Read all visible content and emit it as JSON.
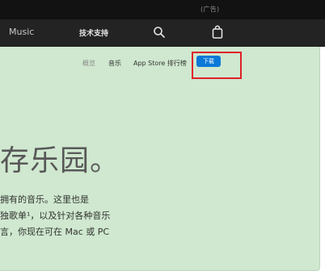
{
  "ad_label": "(广告)",
  "nav": {
    "music_label": "Music",
    "support_label": "技术支持",
    "search_icon": "search-icon",
    "bag_icon": "bag-icon"
  },
  "subnav": {
    "overview_label": "概览",
    "music_label": "音乐",
    "charts_label": "App Store 排行榜",
    "download_label": "下载"
  },
  "content": {
    "headline": "存乐园。",
    "line1": "拥有的音乐。这里也是",
    "line2": "独歌单¹，以及针对各种音乐",
    "line3": "言，你现在可在 Mac 或 PC"
  },
  "colors": {
    "nav_background": "#232323",
    "panel_background": "#cfe8cf",
    "download_button": "#0a78d8",
    "highlight_outline": "#e0202a"
  }
}
